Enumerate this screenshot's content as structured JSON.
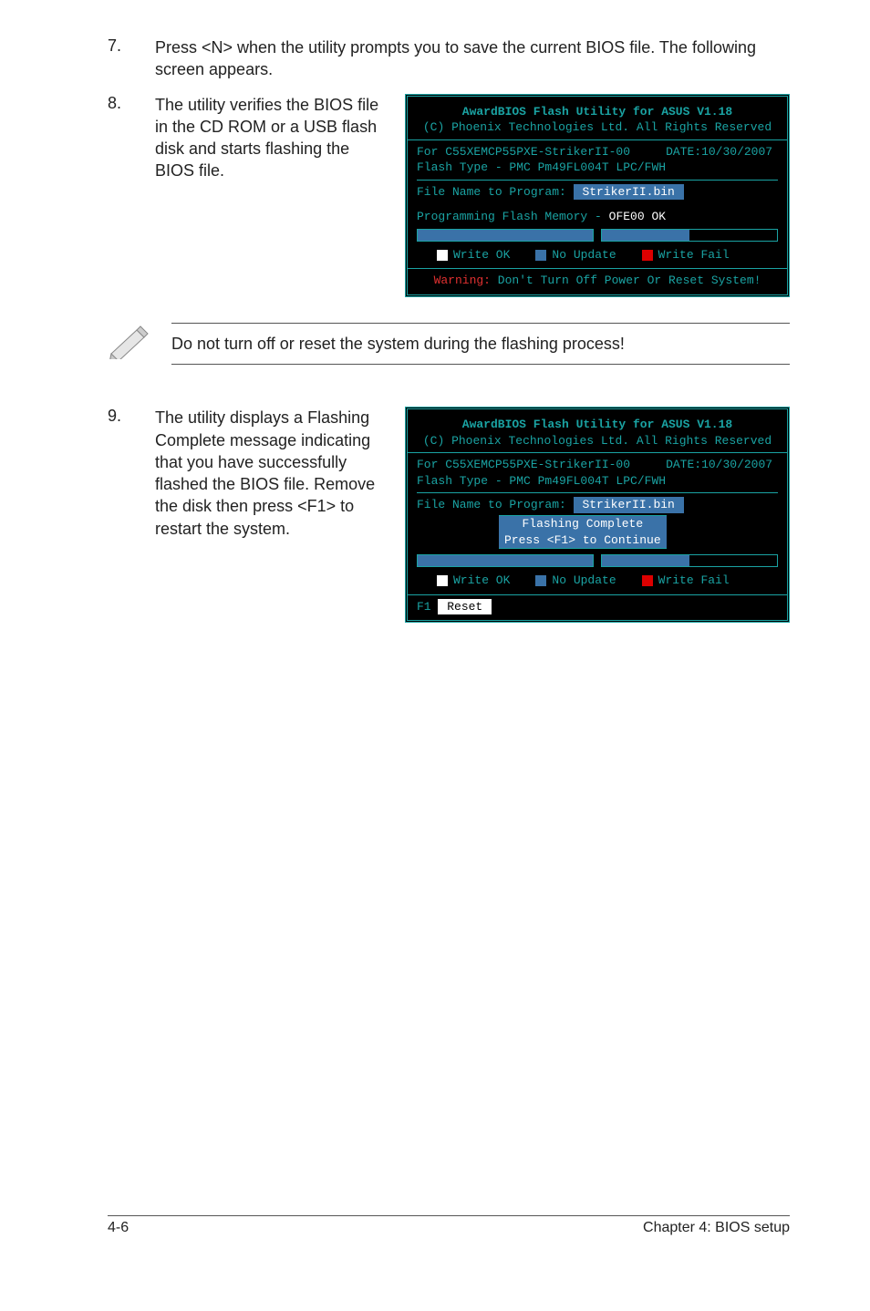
{
  "steps": {
    "s7": {
      "num": "7.",
      "text": "Press <N> when the utility prompts you to save the current BIOS file. The following screen appears."
    },
    "s8": {
      "num": "8.",
      "text": "The utility verifies the BIOS file in the CD ROM or a USB flash disk and starts flashing the BIOS file."
    },
    "s9": {
      "num": "9.",
      "text": "The utility displays a Flashing Complete message indicating that you have successfully flashed the BIOS file. Remove the disk then press <F1> to restart the system."
    }
  },
  "note": "Do not turn off or reset the system during the flashing process!",
  "term": {
    "title": "AwardBIOS Flash Utility for ASUS V1.18",
    "copyright": "(C) Phoenix Technologies Ltd. All Rights Reserved",
    "for_model": "For C55XEMCP55PXE-StrikerII-00",
    "date": "DATE:10/30/2007",
    "flash_type": "Flash Type - PMC Pm49FL004T LPC/FWH",
    "file_label": "File Name to Program:",
    "file_name": " StrikerII.bin ",
    "programming": "Programming Flash Memory -",
    "ofe": " OFE00 OK",
    "legend_ok": "Write OK",
    "legend_no": "No Update",
    "legend_fail": "Write Fail",
    "warning_label": "Warning:",
    "warning_rest": " Don't Turn Off Power Or Reset System!",
    "msg1": "Flashing Complete",
    "msg2": "Press <F1> to Continue",
    "f1": "F1",
    "reset": " Reset "
  },
  "footer": {
    "left": "4-6",
    "right": "Chapter 4: BIOS setup"
  }
}
